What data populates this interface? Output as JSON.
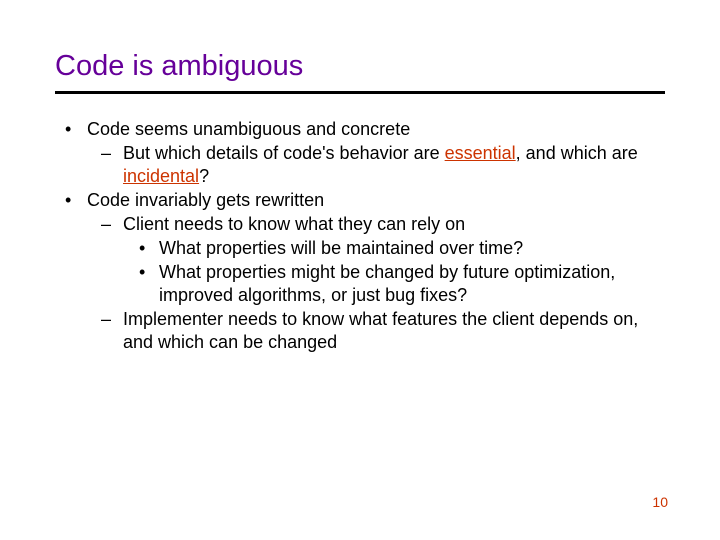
{
  "title": "Code is ambiguous",
  "bullets": {
    "b1": "Code seems unambiguous and concrete",
    "b1a_pre": "But which details of code's behavior are ",
    "b1a_hl1": "essential",
    "b1a_mid": ", and which are ",
    "b1a_hl2": "incidental",
    "b1a_post": "?",
    "b2": "Code invariably gets rewritten",
    "b2a": "Client needs to know what they can rely on",
    "b2a1": "What properties will be maintained over time?",
    "b2a2": "What properties might be changed by future optimization, improved algorithms, or just bug fixes?",
    "b2b": "Implementer needs to know what features the client depends on, and which can be changed"
  },
  "pagenum": "10"
}
